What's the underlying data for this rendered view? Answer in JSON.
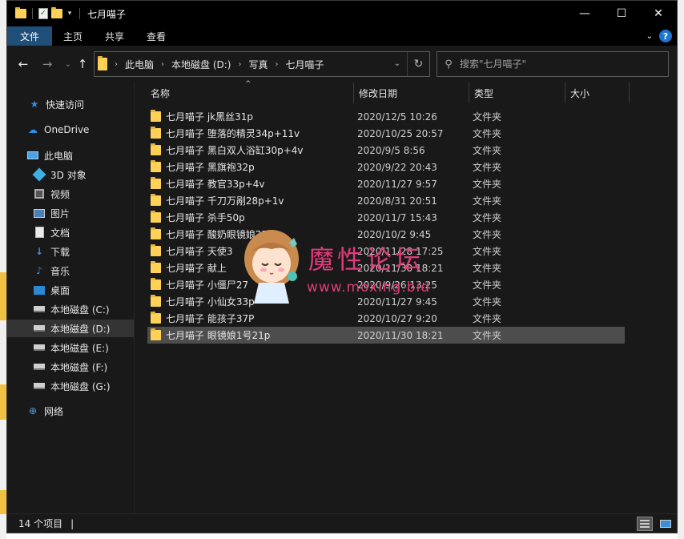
{
  "window": {
    "title": "七月喵子",
    "controls": {
      "minimize": "—",
      "maximize": "☐",
      "close": "✕"
    }
  },
  "ribbon": {
    "tabs": [
      "文件",
      "主页",
      "共享",
      "查看"
    ],
    "help": "?"
  },
  "address": {
    "crumbs": [
      "此电脑",
      "本地磁盘 (D:)",
      "写真",
      "七月喵子"
    ]
  },
  "search": {
    "placeholder": "搜索\"七月喵子\""
  },
  "nav": {
    "quick_access": "快速访问",
    "onedrive": "OneDrive",
    "this_pc": "此电脑",
    "items": [
      "3D 对象",
      "视频",
      "图片",
      "文档",
      "下载",
      "音乐",
      "桌面",
      "本地磁盘 (C:)",
      "本地磁盘 (D:)",
      "本地磁盘 (E:)",
      "本地磁盘 (F:)",
      "本地磁盘 (G:)"
    ],
    "network": "网络",
    "selected": "本地磁盘 (D:)"
  },
  "columns": {
    "name": "名称",
    "date": "修改日期",
    "type": "类型",
    "size": "大小"
  },
  "files": [
    {
      "name": "七月喵子 jk黑丝31p",
      "date": "2020/12/5 10:26",
      "type": "文件夹"
    },
    {
      "name": "七月喵子 堕落的精灵34p+11v",
      "date": "2020/10/25 20:57",
      "type": "文件夹"
    },
    {
      "name": "七月喵子 黑白双人浴缸30p+4v",
      "date": "2020/9/5 8:56",
      "type": "文件夹"
    },
    {
      "name": "七月喵子 黑旗袍32p",
      "date": "2020/9/22 20:43",
      "type": "文件夹"
    },
    {
      "name": "七月喵子 教官33p+4v",
      "date": "2020/11/27 9:57",
      "type": "文件夹"
    },
    {
      "name": "七月喵子 千刀万剐28p+1v",
      "date": "2020/8/31 20:51",
      "type": "文件夹"
    },
    {
      "name": "七月喵子 杀手50p",
      "date": "2020/11/7 15:43",
      "type": "文件夹"
    },
    {
      "name": "七月喵子 酸奶眼镜娘25P",
      "date": "2020/10/2 9:45",
      "type": "文件夹"
    },
    {
      "name": "七月喵子 天使3",
      "date": "2020/11/28 17:25",
      "type": "文件夹"
    },
    {
      "name": "七月喵子 献上",
      "date": "2020/11/30 18:21",
      "type": "文件夹"
    },
    {
      "name": "七月喵子 小僵尸27",
      "date": "2020/9/26 13:25",
      "type": "文件夹"
    },
    {
      "name": "七月喵子 小仙女33p",
      "date": "2020/11/27 9:45",
      "type": "文件夹"
    },
    {
      "name": "七月喵子 能孩子37P",
      "date": "2020/10/27 9:20",
      "type": "文件夹"
    },
    {
      "name": "七月喵子 眼镜娘1号21p",
      "date": "2020/11/30 18:21",
      "type": "文件夹",
      "selected": true
    }
  ],
  "watermark": {
    "title": "魔性论坛",
    "url": "www.moxing.bid"
  },
  "status": {
    "count": "14 个项目"
  },
  "colors": {
    "folder": "#ffd257",
    "accent": "#1f4e79",
    "watermark": "#e23b7a",
    "background": "#191919"
  }
}
